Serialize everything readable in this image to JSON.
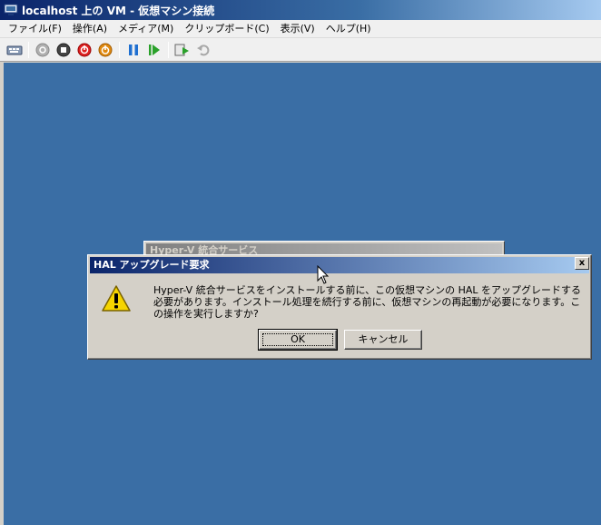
{
  "window": {
    "title": "localhost 上の VM  - 仮想マシン接続"
  },
  "menu": {
    "items": [
      "ファイル(F)",
      "操作(A)",
      "メディア(M)",
      "クリップボード(C)",
      "表示(V)",
      "ヘルプ(H)"
    ]
  },
  "toolbar": {
    "icons": [
      "ctrl-alt-del-icon",
      "start-icon",
      "turn-off-icon",
      "shutdown-icon",
      "save-state-icon",
      "pause-icon",
      "resume-icon",
      "snapshot-icon",
      "revert-icon"
    ]
  },
  "background_window": {
    "title": "Hyper-V 統合サービス"
  },
  "dialog": {
    "title": "HAL アップグレード要求",
    "close": "x",
    "message": "Hyper-V 統合サービスをインストールする前に、この仮想マシンの HAL をアップグレードする必要があります。インストール処理を続行する前に、仮想マシンの再起動が必要になります。この操作を実行しますか?",
    "ok_label": "OK",
    "cancel_label": "キャンセル"
  },
  "colors": {
    "desktop": "#3a6ea5",
    "titlebar_active": "#0a246a",
    "dialog_face": "#d4d0c8"
  }
}
